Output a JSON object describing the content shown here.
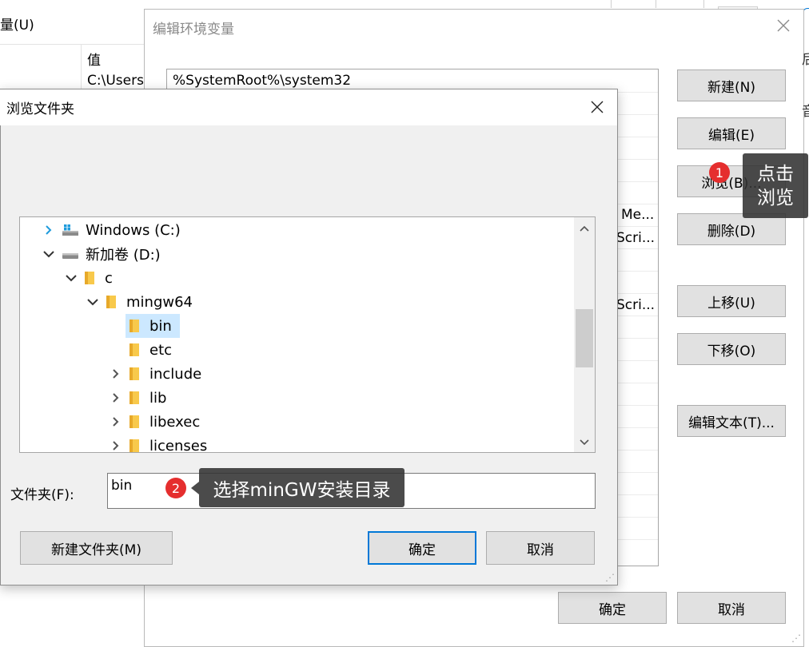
{
  "background_window": {
    "partial_menu": "量(U)",
    "column_value": "值",
    "row_value": "C:\\Users\\",
    "fragments": [
      "Me...",
      "Scri...",
      "Scri..."
    ],
    "right_edge_text": [
      "后",
      "音"
    ]
  },
  "edit_dialog": {
    "title": "编辑环境变量",
    "entries": [
      "%SystemRoot%\\system32"
    ],
    "buttons": {
      "new": "新建(N)",
      "edit": "编辑(E)",
      "browse": "浏览(B)...",
      "delete": "删除(D)",
      "move_up": "上移(U)",
      "move_down": "下移(O)",
      "edit_text": "编辑文本(T)...",
      "ok": "确定",
      "cancel": "取消"
    }
  },
  "browse_dialog": {
    "title": "浏览文件夹",
    "tree": [
      {
        "label": "Windows (C:)",
        "level": 0,
        "expanded": false,
        "type": "drive"
      },
      {
        "label": "新加卷 (D:)",
        "level": 0,
        "expanded": true,
        "type": "drive"
      },
      {
        "label": "c",
        "level": 1,
        "expanded": true,
        "type": "folder"
      },
      {
        "label": "mingw64",
        "level": 2,
        "expanded": true,
        "type": "folder"
      },
      {
        "label": "bin",
        "level": 3,
        "expanded": null,
        "type": "folder",
        "selected": true
      },
      {
        "label": "etc",
        "level": 3,
        "expanded": null,
        "type": "folder"
      },
      {
        "label": "include",
        "level": 3,
        "expanded": false,
        "type": "folder"
      },
      {
        "label": "lib",
        "level": 3,
        "expanded": false,
        "type": "folder"
      },
      {
        "label": "libexec",
        "level": 3,
        "expanded": false,
        "type": "folder"
      },
      {
        "label": "licenses",
        "level": 3,
        "expanded": false,
        "type": "folder"
      }
    ],
    "folder_label": "文件夹(F):",
    "folder_value": "bin",
    "buttons": {
      "new_folder": "新建文件夹(M)",
      "ok": "确定",
      "cancel": "取消"
    }
  },
  "annotations": [
    {
      "number": "1",
      "text_line1": "点击",
      "text_line2": "浏览"
    },
    {
      "number": "2",
      "text": "选择minGW安装目录"
    }
  ],
  "colors": {
    "accent": "#0078d7",
    "selection": "#cce8ff",
    "folder": "#f8c94b",
    "badge": "#e52e2e"
  }
}
